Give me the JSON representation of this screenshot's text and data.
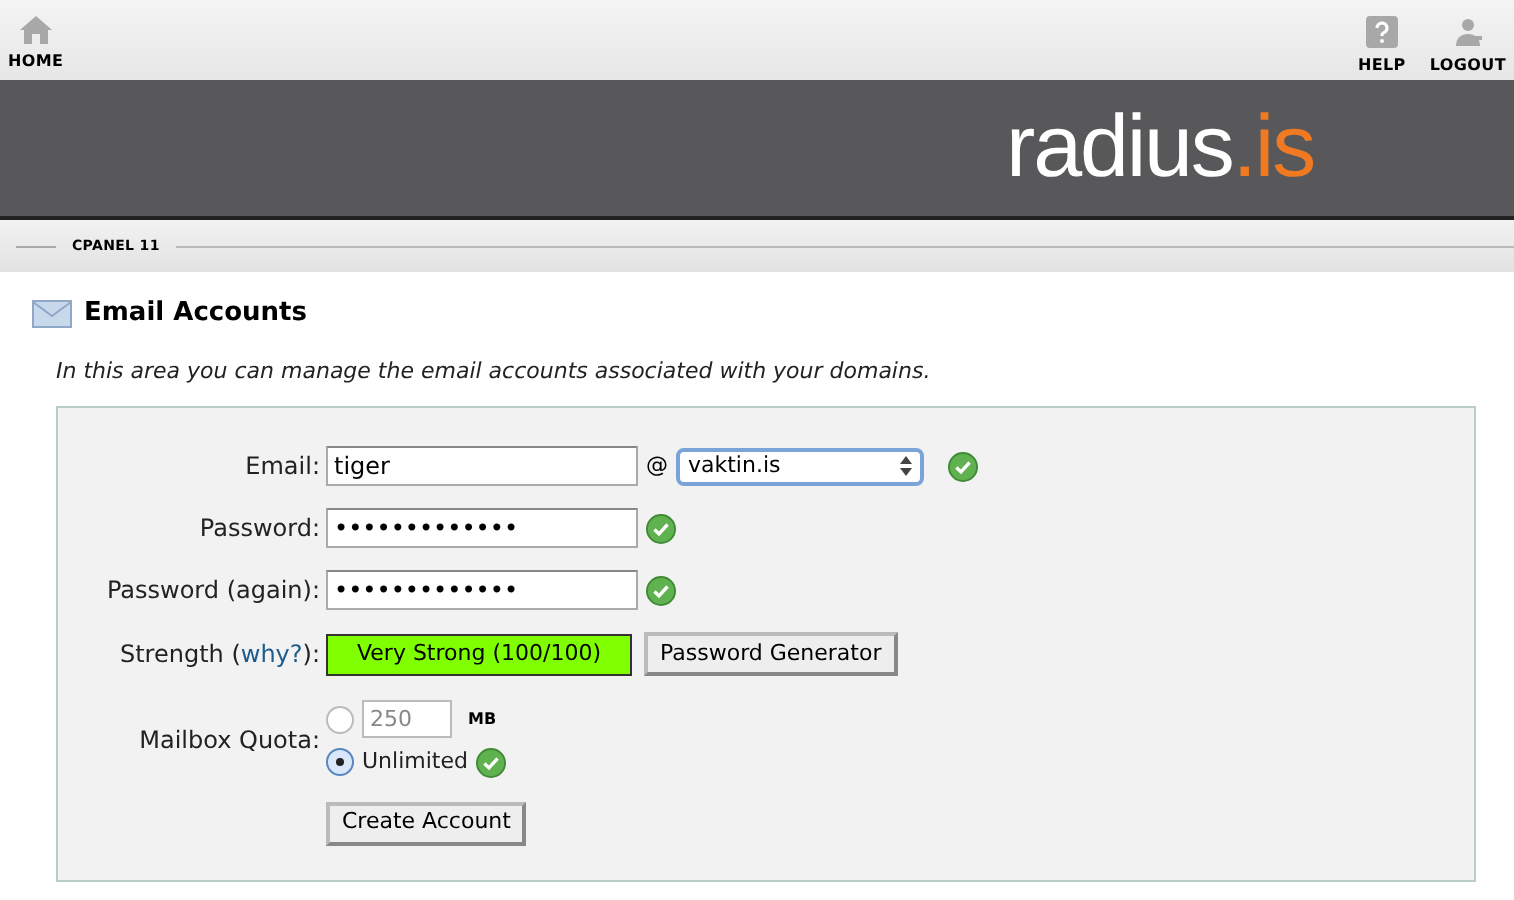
{
  "top_nav": {
    "left": [
      {
        "label": "HOME",
        "kind": "home"
      }
    ],
    "right": [
      {
        "label": "HELP",
        "kind": "help"
      },
      {
        "label": "LOGOUT",
        "kind": "logout"
      }
    ]
  },
  "logo": {
    "name": "radius",
    "suffix": ".is"
  },
  "breadcrumb": "CPANEL 11",
  "heading": "Email Accounts",
  "description": "In this area you can manage the email accounts associated with your domains.",
  "form": {
    "email": {
      "label": "Email:",
      "value": "tiger",
      "at": "@",
      "domain": "vaktin.is",
      "valid": true
    },
    "password": {
      "label": "Password:",
      "value": "•••••••••••••",
      "valid": true
    },
    "password_again": {
      "label": "Password (again):",
      "value": "•••••••••••••",
      "valid": true
    },
    "strength": {
      "label_before": "Strength (",
      "link": "why?",
      "label_after": "):",
      "meter": "Very Strong (100/100)",
      "generator_button": "Password Generator"
    },
    "quota": {
      "label": "Mailbox Quota:",
      "valid": true,
      "options": [
        {
          "kind": "size",
          "value": "250",
          "unit": "MB",
          "selected": false
        },
        {
          "kind": "unlimited",
          "label": "Unlimited",
          "selected": true
        }
      ]
    },
    "submit": "Create Account"
  }
}
